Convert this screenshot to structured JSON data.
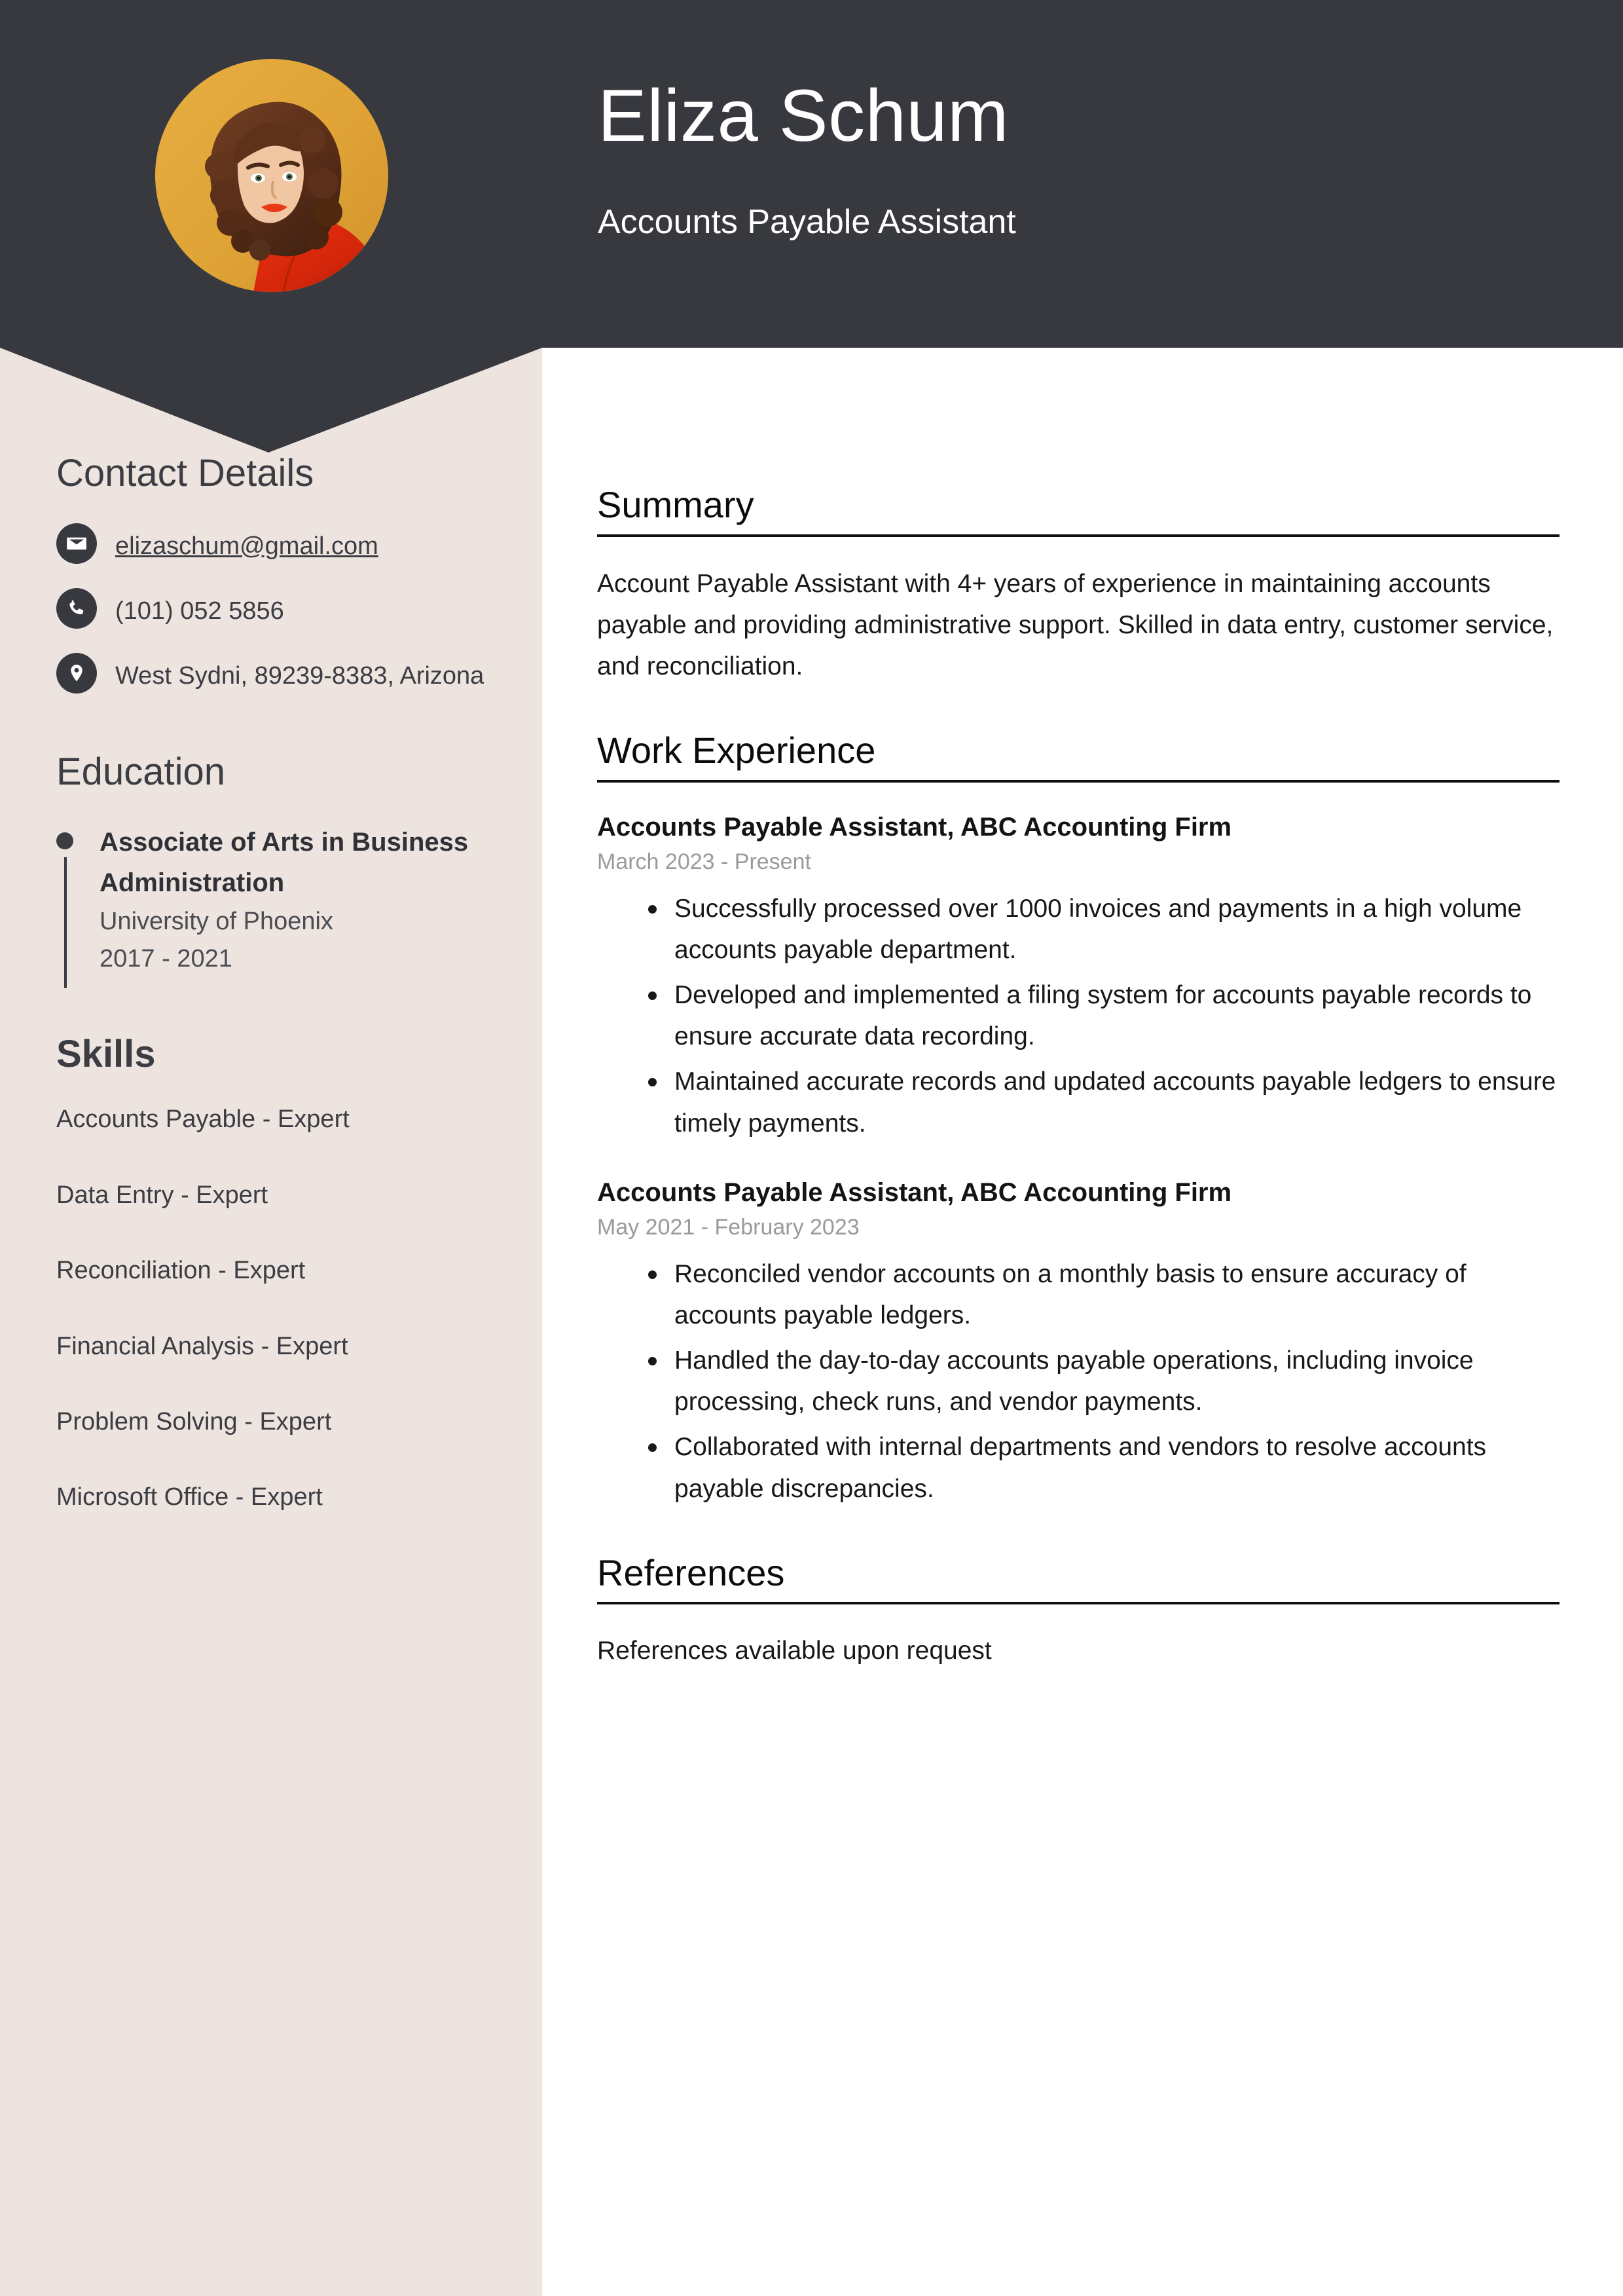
{
  "theme": {
    "header_bg": "#37393f",
    "sidebar_bg": "#ede4e0",
    "main_bg": "#ffffff",
    "photo_bg": "#e0a63a",
    "heading_color": "#0b0b0b",
    "muted_text": "#9a9a9a"
  },
  "header": {
    "name": "Eliza Schum",
    "job_title": "Accounts Payable Assistant",
    "photo_alt": "Portrait of a woman with curly auburn hair wearing a red top on a golden background"
  },
  "sidebar": {
    "contact": {
      "heading": "Contact Details",
      "items": [
        {
          "icon": "envelope-icon",
          "value": "elizaschum@gmail.com",
          "is_link": true
        },
        {
          "icon": "phone-icon",
          "value": "(101) 052 5856",
          "is_link": false
        },
        {
          "icon": "map-pin-icon",
          "value": "West Sydni, 89239-8383, Arizona",
          "is_link": false
        }
      ]
    },
    "education": {
      "heading": "Education",
      "items": [
        {
          "degree": "Associate of Arts in Business Administration",
          "school": "University of Phoenix",
          "dates": "2017 - 2021"
        }
      ]
    },
    "skills": {
      "heading": "Skills",
      "items": [
        "Accounts Payable - Expert",
        "Data Entry - Expert",
        "Reconciliation - Expert",
        "Financial Analysis - Expert",
        "Problem Solving - Expert",
        "Microsoft Office - Expert"
      ]
    }
  },
  "main": {
    "summary": {
      "heading": "Summary",
      "text": "Account Payable Assistant with 4+ years of experience in maintaining accounts payable and providing administrative support. Skilled in data entry, customer service, and reconciliation."
    },
    "work_experience": {
      "heading": "Work Experience",
      "jobs": [
        {
          "title": "Accounts Payable Assistant, ABC Accounting Firm",
          "dates": "March 2023 - Present",
          "bullets": [
            "Successfully processed over 1000 invoices and payments in a high volume accounts payable department.",
            "Developed and implemented a filing system for accounts payable records to ensure accurate data recording.",
            "Maintained accurate records and updated accounts payable ledgers to ensure timely payments."
          ]
        },
        {
          "title": "Accounts Payable Assistant, ABC Accounting Firm",
          "dates": "May 2021 - February 2023",
          "bullets": [
            "Reconciled vendor accounts on a monthly basis to ensure accuracy of accounts payable ledgers.",
            "Handled the day-to-day accounts payable operations, including invoice processing, check runs, and vendor payments.",
            "Collaborated with internal departments and vendors to resolve accounts payable discrepancies."
          ]
        }
      ]
    },
    "references": {
      "heading": "References",
      "text": "References available upon request"
    }
  }
}
